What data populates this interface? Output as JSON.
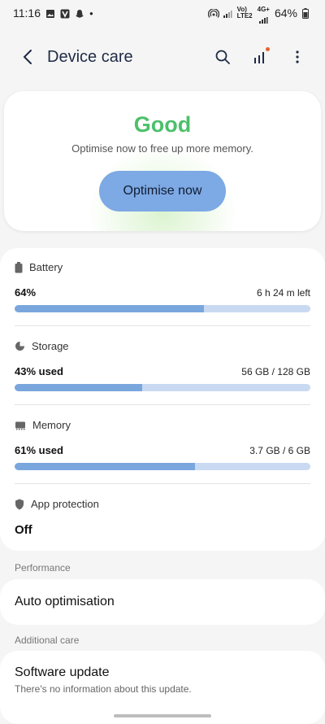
{
  "status_bar": {
    "time": "11:16",
    "carrier_top": "Vo)",
    "carrier_bottom": "LTE2",
    "net": "4G+",
    "battery": "64%"
  },
  "app_bar": {
    "title": "Device care"
  },
  "hero": {
    "status": "Good",
    "subtitle": "Optimise now to free up more memory.",
    "button": "Optimise now",
    "status_color": "#4cc06a"
  },
  "sections": {
    "battery": {
      "label": "Battery",
      "value": "64%",
      "meta": "6 h 24 m left",
      "fill": 0.64
    },
    "storage": {
      "label": "Storage",
      "value": "43% used",
      "meta": "56 GB / 128 GB",
      "fill": 0.43
    },
    "memory": {
      "label": "Memory",
      "value": "61% used",
      "meta": "3.7 GB / 6 GB",
      "fill": 0.61
    },
    "app_protection": {
      "label": "App protection",
      "value": "Off"
    }
  },
  "performance": {
    "label": "Performance",
    "auto_optimisation": "Auto optimisation"
  },
  "additional": {
    "label": "Additional care",
    "software_update_title": "Software update",
    "software_update_sub": "There's no information about this update."
  }
}
